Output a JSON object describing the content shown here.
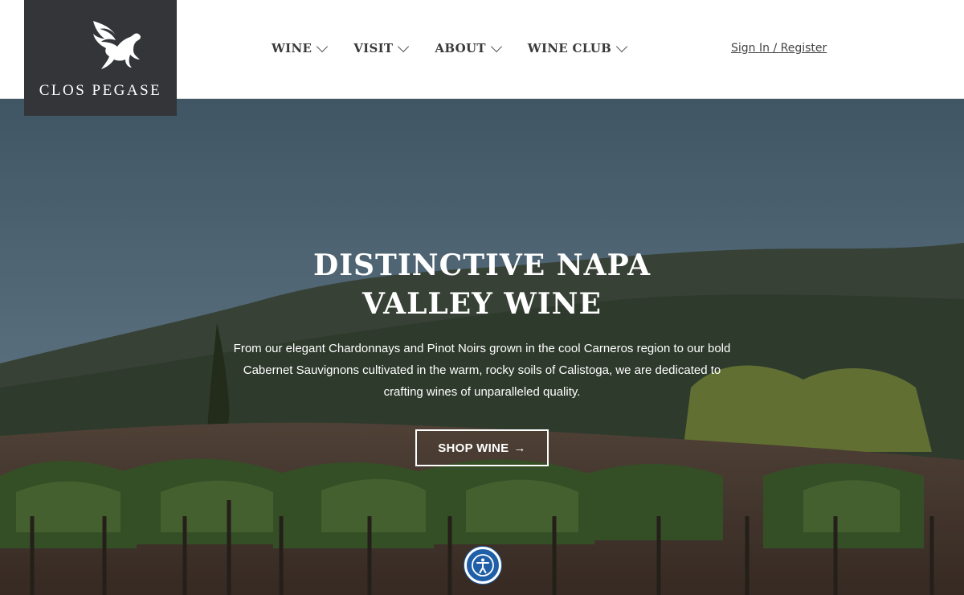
{
  "brand": {
    "name": "CLOS PEGASE",
    "logo_icon": "pegasus-icon"
  },
  "nav": {
    "items": [
      {
        "label": "WINE",
        "icon": "chevron-down-icon"
      },
      {
        "label": "VISIT",
        "icon": "chevron-down-icon"
      },
      {
        "label": "ABOUT",
        "icon": "chevron-down-icon"
      },
      {
        "label": "WINE CLUB",
        "icon": "chevron-down-icon"
      }
    ],
    "signin": "Sign In / Register"
  },
  "hero": {
    "title_line1": "DISTINCTIVE NAPA",
    "title_line2": "VALLEY WINE",
    "body": "From our elegant Chardonnays and Pinot Noirs grown in the cool Carneros region to our bold Cabernet Sauvignons cultivated in the warm, rocky soils of Calistoga, we are dedicated to crafting wines of unparalleled quality.",
    "button_label": "SHOP WINE",
    "button_icon": "arrow-right-icon"
  },
  "accessibility": {
    "icon": "accessibility-icon"
  },
  "colors": {
    "logo_bg": "#333538",
    "accessibility_bg": "#1f5fa8",
    "nav_text": "#3a3a3a"
  }
}
